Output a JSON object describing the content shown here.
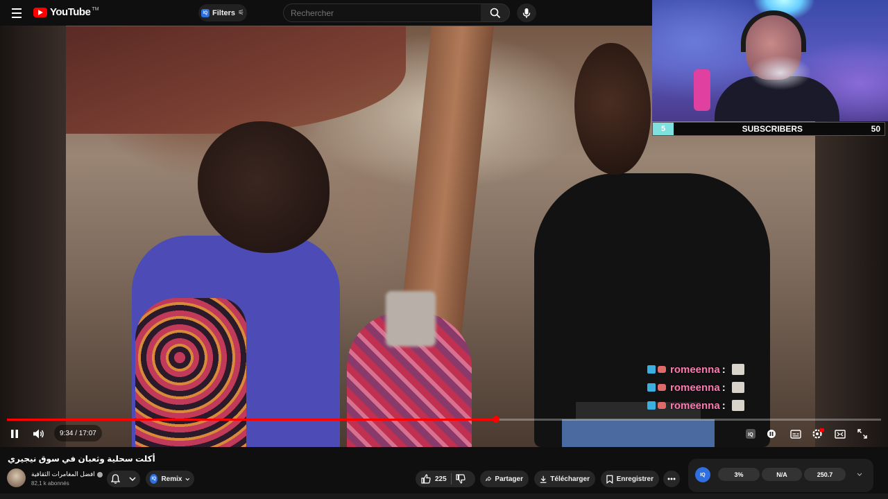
{
  "header": {
    "logo_text": "YouTube",
    "logo_tm": "TM",
    "filters_label": "Filters",
    "search_placeholder": "Rechercher"
  },
  "overlay": {
    "subscribers_current": "5",
    "subscribers_label": "SUBSCRIBERS",
    "subscribers_goal": "50",
    "chat": [
      {
        "name": "romeenna",
        "separator": ":"
      },
      {
        "name": "romeenna",
        "separator": ":"
      },
      {
        "name": "romeenna",
        "separator": ":"
      }
    ]
  },
  "player": {
    "time": "9:34 / 17:07",
    "progress_fraction": 0.5596
  },
  "video": {
    "title": "أكلت سحلية وثعبان في سوق نيجيري",
    "channel_name": "افضل المغامرات الثقافية",
    "subscribers": "82,1 k abonnés"
  },
  "actions": {
    "remix_label": "Remix",
    "like_count": "225",
    "share_label": "Partager",
    "download_label": "Télécharger",
    "save_label": "Enregistrer"
  },
  "stats": {
    "iq_label": "IQ",
    "percent": "3%",
    "na": "N/A",
    "value": "250.7"
  },
  "colors": {
    "accent_red": "#ff0000",
    "iq_blue": "#2f6fe0",
    "chat_name": "#ff7ab0",
    "sub_fill": "#7fe0e0"
  }
}
